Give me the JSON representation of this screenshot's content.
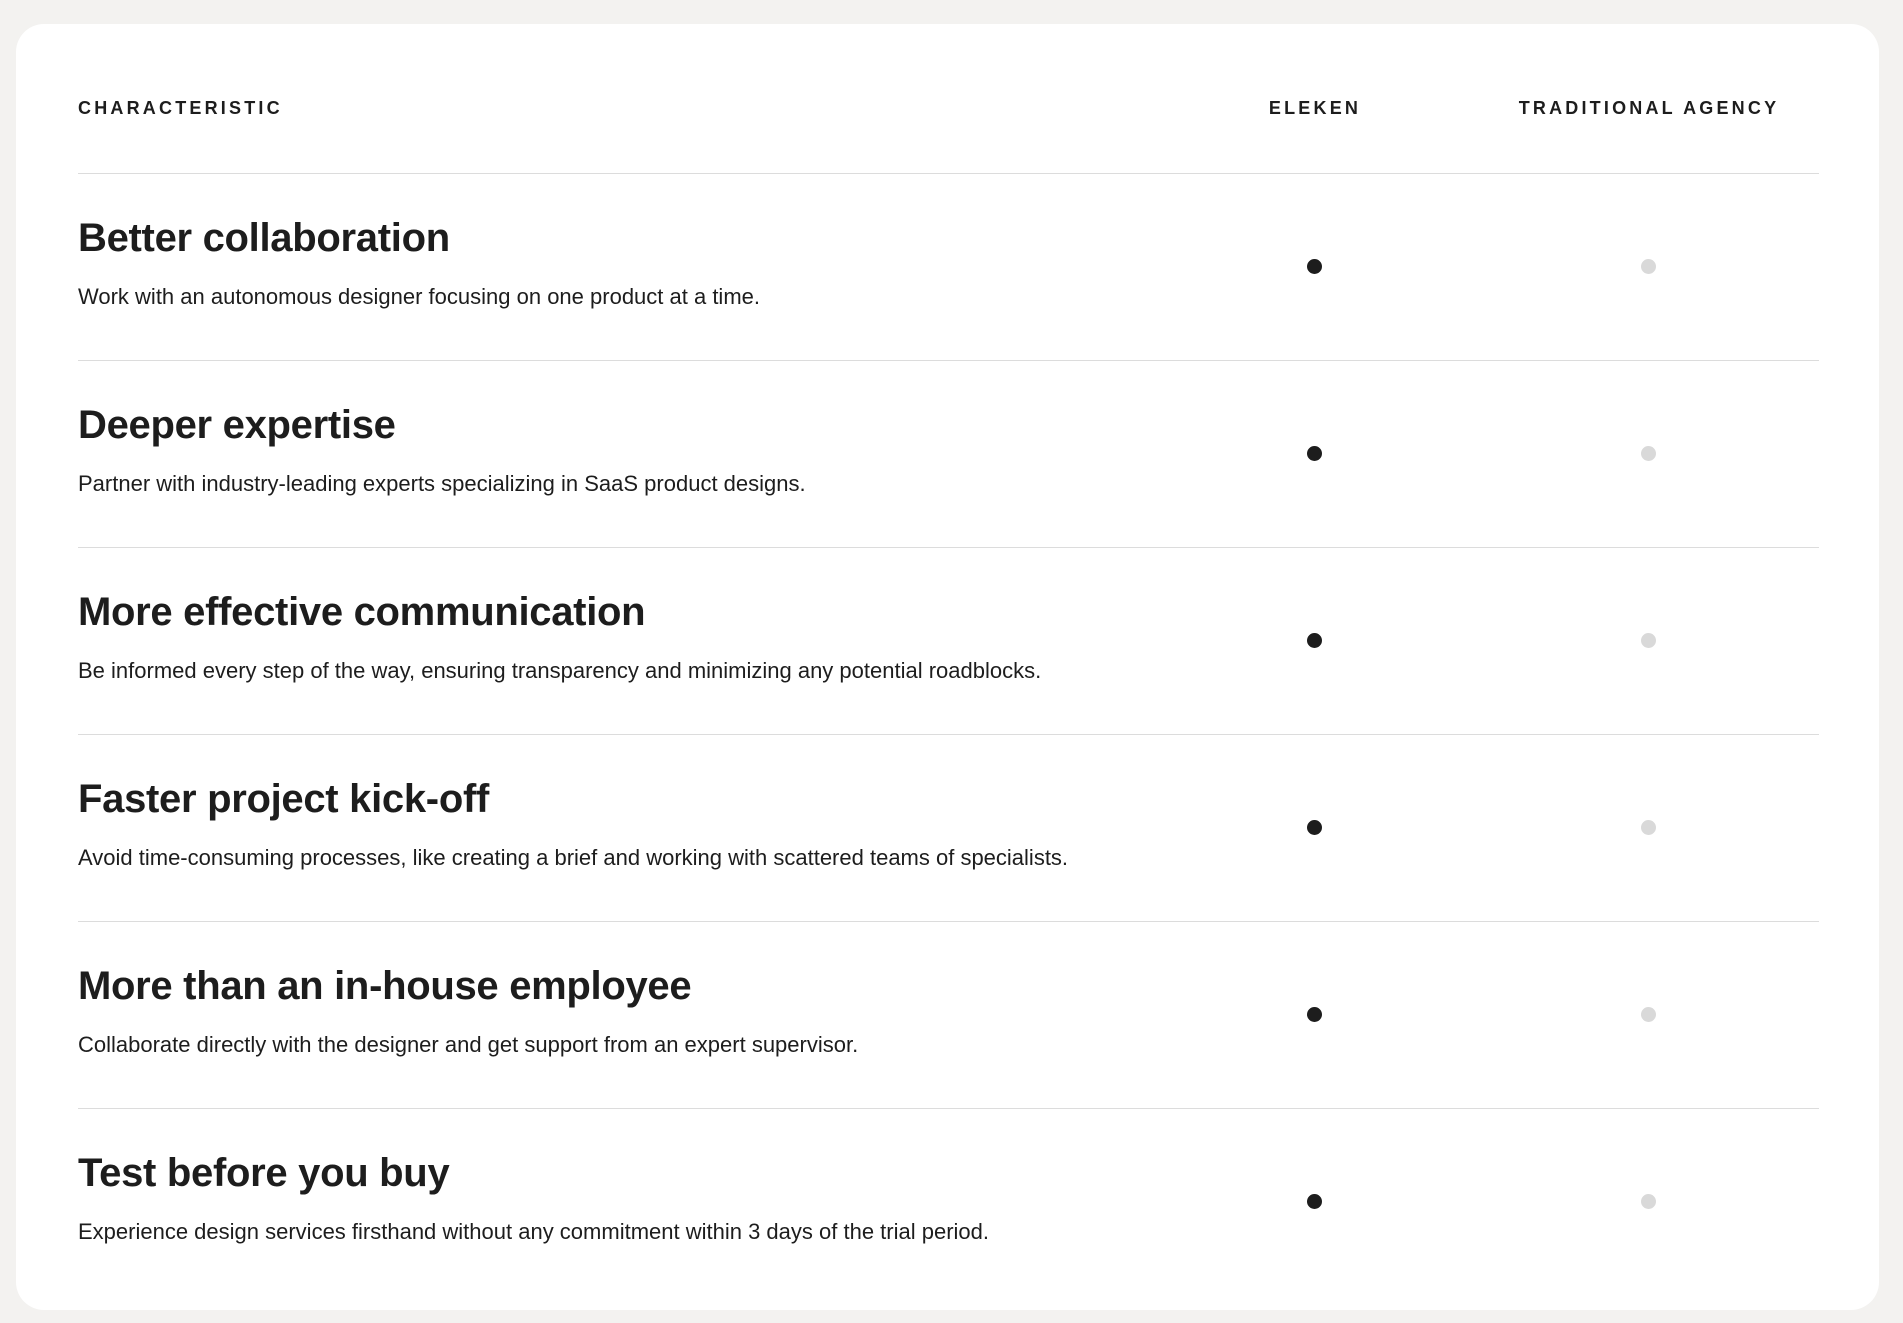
{
  "header": {
    "characteristic": "CHARACTERISTIC",
    "eleken": "ELEKEN",
    "traditional_agency": "TRADITIONAL AGENCY"
  },
  "rows": [
    {
      "title": "Better collaboration",
      "description": "Work with an autonomous designer focusing on one product at a time.",
      "eleken": "filled-dot-icon",
      "agency": "empty-dot-icon"
    },
    {
      "title": "Deeper expertise",
      "description": "Partner with industry-leading experts specializing in SaaS product designs.",
      "eleken": "filled-dot-icon",
      "agency": "empty-dot-icon"
    },
    {
      "title": "More effective communication",
      "description": "Be informed every step of the way, ensuring transparency and minimizing any potential roadblocks.",
      "eleken": "filled-dot-icon",
      "agency": "empty-dot-icon"
    },
    {
      "title": "Faster project kick-off",
      "description": "Avoid time-consuming processes, like creating a brief and working with scattered teams of specialists.",
      "eleken": "filled-dot-icon",
      "agency": "empty-dot-icon"
    },
    {
      "title": "More than an in-house employee",
      "description": "Collaborate directly with the designer and get support from an expert supervisor.",
      "eleken": "filled-dot-icon",
      "agency": "empty-dot-icon"
    },
    {
      "title": "Test before you buy",
      "description": "Experience design services firsthand without any commitment within 3 days of the trial period.",
      "eleken": "filled-dot-icon",
      "agency": "empty-dot-icon"
    }
  ],
  "colors": {
    "page_background": "#f3f2f0",
    "card_background": "#ffffff",
    "text": "#1d1d1d",
    "eleken_dot": "#1d1d1d",
    "agency_dot": "#d9d9d9",
    "divider": "#dcdcdc"
  }
}
